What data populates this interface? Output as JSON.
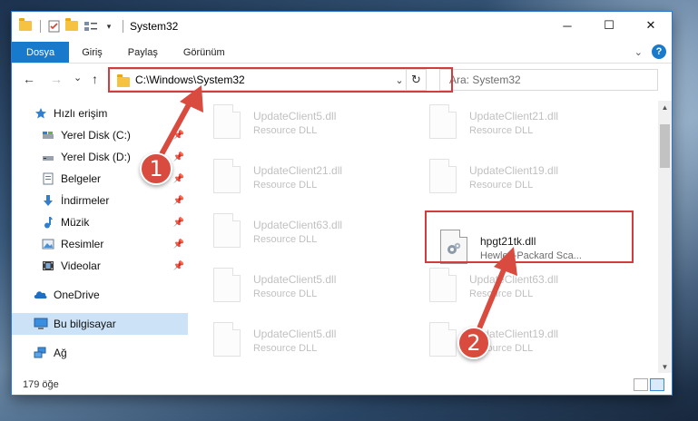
{
  "window": {
    "title": "System32",
    "controls": {
      "minimize": "─",
      "maximize": "☐",
      "close": "✕"
    }
  },
  "ribbon": {
    "tabs": [
      {
        "label": "Dosya",
        "active": true
      },
      {
        "label": "Giriş",
        "active": false
      },
      {
        "label": "Paylaş",
        "active": false
      },
      {
        "label": "Görünüm",
        "active": false
      }
    ],
    "expand_glyph": "⌄",
    "help_glyph": "?"
  },
  "nav": {
    "back": "←",
    "forward": "→",
    "recent": "⌄",
    "up": "↑"
  },
  "address": {
    "path": "C:\\Windows\\System32",
    "dropdown": "⌄",
    "refresh": "↻"
  },
  "search": {
    "placeholder": "Ara: System32"
  },
  "sidebar": {
    "items": [
      {
        "label": "Hızlı erişim",
        "icon": "star-icon",
        "pinned": false
      },
      {
        "label": "Yerel Disk (C:)",
        "icon": "drive-icon",
        "pinned": true
      },
      {
        "label": "Yerel Disk (D:)",
        "icon": "drive-icon",
        "pinned": true
      },
      {
        "label": "Belgeler",
        "icon": "documents-icon",
        "pinned": true
      },
      {
        "label": "İndirmeler",
        "icon": "download-icon",
        "pinned": true
      },
      {
        "label": "Müzik",
        "icon": "music-icon",
        "pinned": true
      },
      {
        "label": "Resimler",
        "icon": "pictures-icon",
        "pinned": true
      },
      {
        "label": "Videolar",
        "icon": "video-icon",
        "pinned": true
      },
      {
        "label": "OneDrive",
        "icon": "cloud-icon",
        "pinned": false
      },
      {
        "label": "Bu bilgisayar",
        "icon": "computer-icon",
        "pinned": false,
        "selected": true
      },
      {
        "label": "Ağ",
        "icon": "network-icon",
        "pinned": false
      }
    ],
    "pin_glyph": "📌"
  },
  "files": [
    {
      "name": "UpdateClient5.dll",
      "desc": "Resource DLL",
      "faded": true
    },
    {
      "name": "UpdateClient21.dll",
      "desc": "Resource DLL",
      "faded": true
    },
    {
      "name": "UpdateClient21.dll",
      "desc": "Resource DLL",
      "faded": true
    },
    {
      "name": "UpdateClient19.dll",
      "desc": "Resource DLL",
      "faded": true
    },
    {
      "name": "UpdateClient63.dll",
      "desc": "Resource DLL",
      "faded": true
    },
    {
      "name": "hpgt21tk.dll",
      "desc": "Hewlett-Packard Sca...",
      "faded": false,
      "highlighted": true
    },
    {
      "name": "UpdateClient5.dll",
      "desc": "Resource DLL",
      "faded": true
    },
    {
      "name": "UpdateClient63.dll",
      "desc": "Resource DLL",
      "faded": true
    },
    {
      "name": "UpdateClient5.dll",
      "desc": "Resource DLL",
      "faded": true
    },
    {
      "name": "UpdateClient19.dll",
      "desc": "Resource DLL",
      "faded": true
    }
  ],
  "status": {
    "item_count": "179 öğe"
  },
  "annotations": {
    "step1": "1",
    "step2": "2",
    "color": "#d94b3f"
  },
  "colors": {
    "accent": "#1979ca",
    "selection": "#cce3f7",
    "highlight_box": "#d23c3c"
  }
}
